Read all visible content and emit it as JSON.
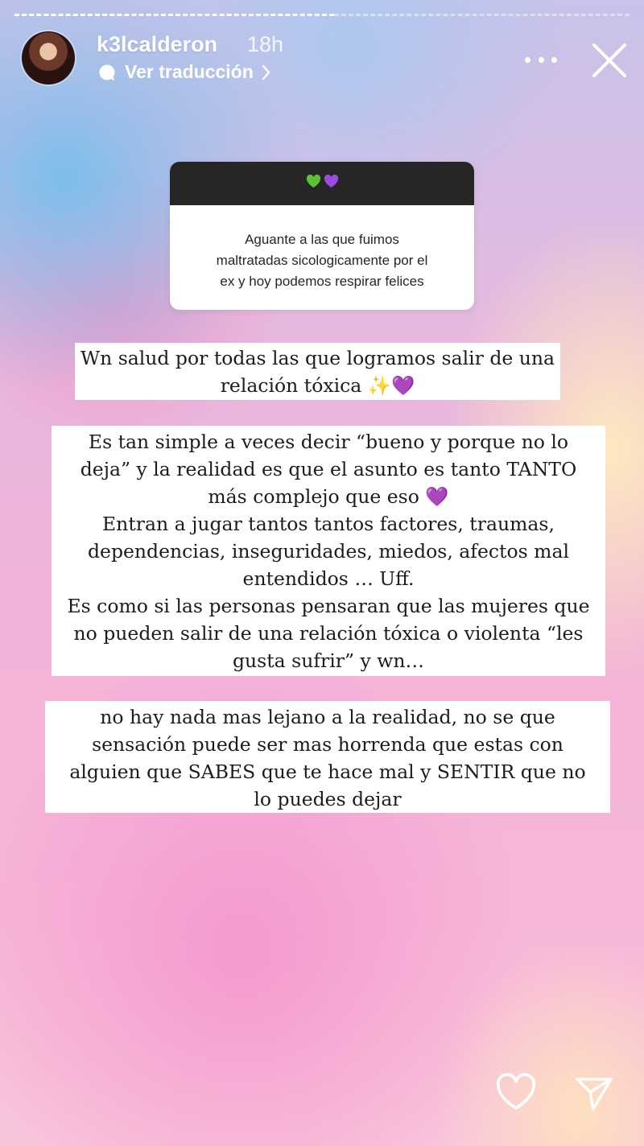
{
  "story": {
    "username": "k3lcalderon",
    "time_ago": "18h",
    "translate_label": "Ver traducción",
    "progress": 0.52
  },
  "question_sticker": {
    "header_emojis": "💚💜",
    "lines": [
      "Aguante a las que fuimos",
      "maltratadas sicologicamente por el",
      "ex y hoy podemos respirar felices"
    ]
  },
  "text_box_1": {
    "lines": [
      "Wn salud por todas las que logramos salir de una",
      "relación tóxica ✨💜"
    ]
  },
  "text_box_2": {
    "lines": [
      "Es tan simple a veces decir “bueno y porque no lo",
      "deja” y la realidad es que el asunto es tanto TANTO",
      "más complejo que eso 💜",
      "Entran a jugar tantos tantos factores, traumas,",
      "dependencias, inseguridades, miedos, afectos mal",
      "entendidos … Uff.",
      "Es como si las personas pensaran que las mujeres que",
      "no pueden salir de una relación tóxica o violenta “les",
      "gusta sufrir” y wn…"
    ]
  },
  "text_box_3": {
    "lines": [
      "no hay nada mas lejano a la realidad, no se que",
      "sensación puede ser mas horrenda que estas con",
      "alguien que SABES que te hace mal y SENTIR que no",
      "lo puedes dejar"
    ]
  },
  "icons": {
    "more": "more-options-icon",
    "close": "close-icon",
    "translate": "chat-bubble-icon",
    "like": "heart-icon",
    "share": "send-icon"
  },
  "colors": {
    "sticker_header": "#262626",
    "heart_green": "#5bc236",
    "heart_purple": "#9b4de0"
  }
}
